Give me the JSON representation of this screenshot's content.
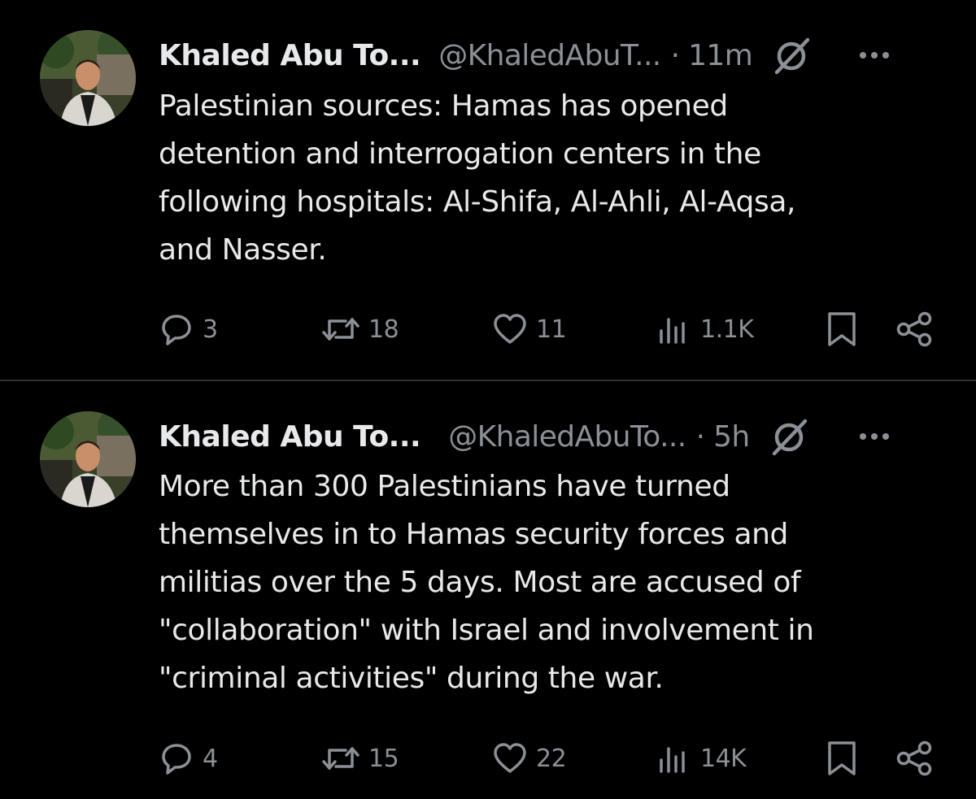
{
  "tweets": [
    {
      "display_name": "Khaled Abu To...",
      "handle": "@KhaledAbuT...",
      "separator": "·",
      "time": "11m",
      "text_lines": [
        "Palestinian sources: Hamas has opened",
        "detention and interrogation centers in the",
        "following hospitals: Al-Shifa, Al-Ahli, Al-Aqsa,",
        "and Nasser."
      ],
      "metrics": {
        "replies": "3",
        "reposts": "18",
        "likes": "11",
        "views": "1.1K"
      }
    },
    {
      "display_name": "Khaled Abu To...",
      "handle": "@KhaledAbuTo...",
      "separator": "·",
      "time": "5h",
      "text_lines": [
        "More than 300 Palestinians have turned",
        "themselves in to Hamas security forces and",
        "militias over the 5 days. Most are accused of",
        "\"collaboration\" with Israel and involvement in",
        "\"criminal activities\" during the war."
      ],
      "metrics": {
        "replies": "4",
        "reposts": "15",
        "likes": "22",
        "views": "14K"
      }
    }
  ],
  "icons": {
    "avatar": "profile-photo",
    "grok": "grok-icon",
    "more": "more-dots-icon",
    "reply": "reply-bubble-icon",
    "repost": "repost-arrows-icon",
    "like": "heart-icon",
    "views": "views-bars-icon",
    "bookmark": "bookmark-icon",
    "share": "share-icon"
  },
  "colors": {
    "background": "#000000",
    "text_primary": "#e7e9ea",
    "text_secondary": "#8b9096",
    "divider": "#2f3336"
  }
}
